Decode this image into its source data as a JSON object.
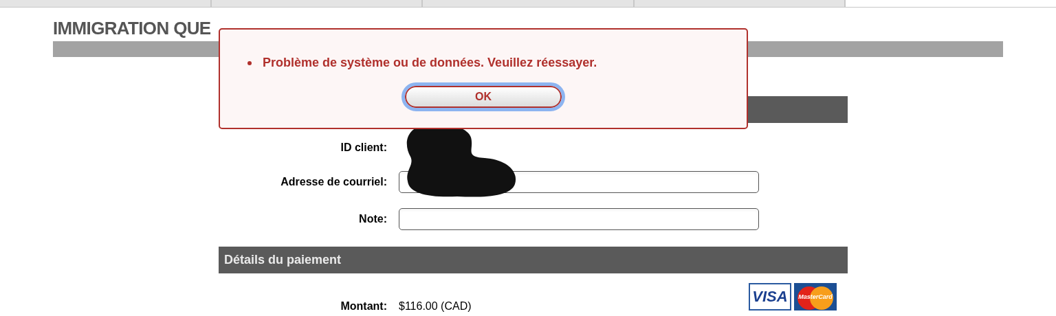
{
  "browser_tabs": [
    {
      "selected": false
    },
    {
      "selected": false
    },
    {
      "selected": false
    },
    {
      "selected": false
    },
    {
      "selected": true
    }
  ],
  "site_title": "IMMIGRATION QUE",
  "form": {
    "rows": [
      {
        "kind": "value",
        "label": "ID client:"
      },
      {
        "kind": "input",
        "label": "Adresse de courriel:"
      },
      {
        "kind": "input",
        "label": "Note:"
      }
    ]
  },
  "payment": {
    "title": "Détails du paiement",
    "amount_label": "Montant:",
    "amount": "$116.00 (CAD)",
    "cards": [
      {
        "kind": "visa",
        "label": "VISA"
      },
      {
        "kind": "mastercard",
        "label": "MasterCard"
      }
    ]
  },
  "dialog": {
    "messages": [
      "Problème de système ou de données. Veuillez réessayer."
    ],
    "button": "OK"
  }
}
